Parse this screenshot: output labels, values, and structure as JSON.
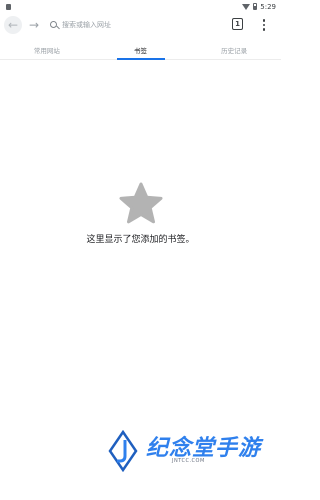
{
  "status_bar": {
    "time": "5:29"
  },
  "toolbar": {
    "search_placeholder": "搜索或输入网址",
    "tab_count": "1"
  },
  "tabs": [
    {
      "label": "常用网站"
    },
    {
      "label": "书签"
    },
    {
      "label": "历史记录"
    }
  ],
  "active_tab": "书签",
  "empty_state": {
    "message": "这里显示了您添加的书签。",
    "icon": "star-icon"
  },
  "watermark": {
    "title": "纪念堂手游",
    "subtitle": "JNTCC.COM"
  },
  "colors": {
    "accent": "#1a73e8",
    "star": "#b3b3b3",
    "watermark": "#2f80ed"
  }
}
